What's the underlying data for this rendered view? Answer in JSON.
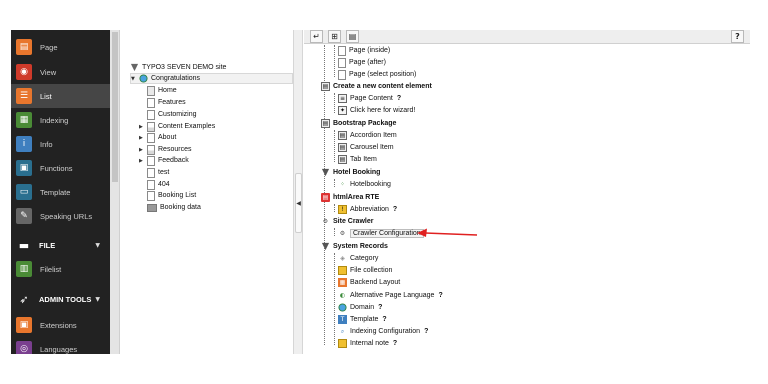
{
  "modules": [
    {
      "label": "Page",
      "icon": "page-icon",
      "color": "#e8762d",
      "glyph": "▤"
    },
    {
      "label": "View",
      "icon": "view-icon",
      "color": "#cf3a2a",
      "glyph": "◉"
    },
    {
      "label": "List",
      "icon": "list-icon",
      "color": "#e8762d",
      "glyph": "☰",
      "active": true
    },
    {
      "label": "Indexing",
      "icon": "indexing-icon",
      "color": "#4a8b36",
      "glyph": "▦"
    },
    {
      "label": "Info",
      "icon": "info-icon",
      "color": "#3f7fbf",
      "glyph": "i"
    },
    {
      "label": "Functions",
      "icon": "functions-icon",
      "color": "#2a6f8f",
      "glyph": "▣"
    },
    {
      "label": "Template",
      "icon": "template-icon",
      "color": "#2a6f8f",
      "glyph": "▭"
    },
    {
      "label": "Speaking URLs",
      "icon": "speaking-urls-icon",
      "color": "#666666",
      "glyph": "✎"
    }
  ],
  "group_file": {
    "label": "FILE",
    "icon": "file-group-icon"
  },
  "filelist": {
    "label": "Filelist",
    "icon": "filelist-icon",
    "color": "#4a8b36",
    "glyph": "▥"
  },
  "group_admin": {
    "label": "ADMIN TOOLS",
    "icon": "admin-tools-icon"
  },
  "admin_modules": [
    {
      "label": "Extensions",
      "icon": "extensions-icon",
      "color": "#e8762d",
      "glyph": "▣"
    },
    {
      "label": "Languages",
      "icon": "languages-icon",
      "color": "#7a3f8f",
      "glyph": "◎"
    }
  ],
  "tree": {
    "root": "TYPO3 SEVEN DEMO site",
    "selected": "Congratulations",
    "items": [
      {
        "label": "Home",
        "icon": "home-page-icon"
      },
      {
        "label": "Features",
        "icon": "page-icon"
      },
      {
        "label": "Customizing",
        "icon": "page-icon"
      },
      {
        "label": "Content Examples",
        "icon": "page-icon",
        "expandable": true
      },
      {
        "label": "About",
        "icon": "page-icon",
        "expandable": true
      },
      {
        "label": "Resources",
        "icon": "page-icon",
        "expandable": true
      },
      {
        "label": "Feedback",
        "icon": "page-icon",
        "expandable": true
      },
      {
        "label": "test",
        "icon": "page-icon"
      },
      {
        "label": "404",
        "icon": "page-icon"
      },
      {
        "label": "Booking List",
        "icon": "page-icon"
      },
      {
        "label": "Booking data",
        "icon": "folder-icon"
      }
    ]
  },
  "docheader": {
    "back": "↵",
    "new": "⊞",
    "view": "▤",
    "help": "?"
  },
  "wizard": {
    "page_items": [
      "Page (inside)",
      "Page (after)",
      "Page (select position)"
    ],
    "sections": [
      {
        "title": "Create a new content element",
        "items": [
          {
            "label": "Page Content",
            "help": "?"
          },
          {
            "label": "Click here for wizard!"
          }
        ]
      },
      {
        "title": "Bootstrap Package",
        "items": [
          {
            "label": "Accordion Item"
          },
          {
            "label": "Carousel Item"
          },
          {
            "label": "Tab Item"
          }
        ]
      },
      {
        "title": "Hotel Booking",
        "items": [
          {
            "label": "Hotelbooking"
          }
        ]
      },
      {
        "title": "htmlArea RTE",
        "items": [
          {
            "label": "Abbreviation",
            "help": "?"
          }
        ]
      },
      {
        "title": "Site Crawler",
        "items": [
          {
            "label": "Crawler Configuration"
          }
        ]
      },
      {
        "title": "System Records",
        "items": [
          {
            "label": "Category"
          },
          {
            "label": "File collection"
          },
          {
            "label": "Backend Layout"
          },
          {
            "label": "Alternative Page Language",
            "help": "?"
          },
          {
            "label": "Domain",
            "help": "?"
          },
          {
            "label": "Template",
            "help": "?"
          },
          {
            "label": "Indexing Configuration",
            "help": "?"
          },
          {
            "label": "Internal note",
            "help": "?"
          }
        ]
      }
    ]
  },
  "colors": {
    "annotation_arrow": "#e02020"
  }
}
